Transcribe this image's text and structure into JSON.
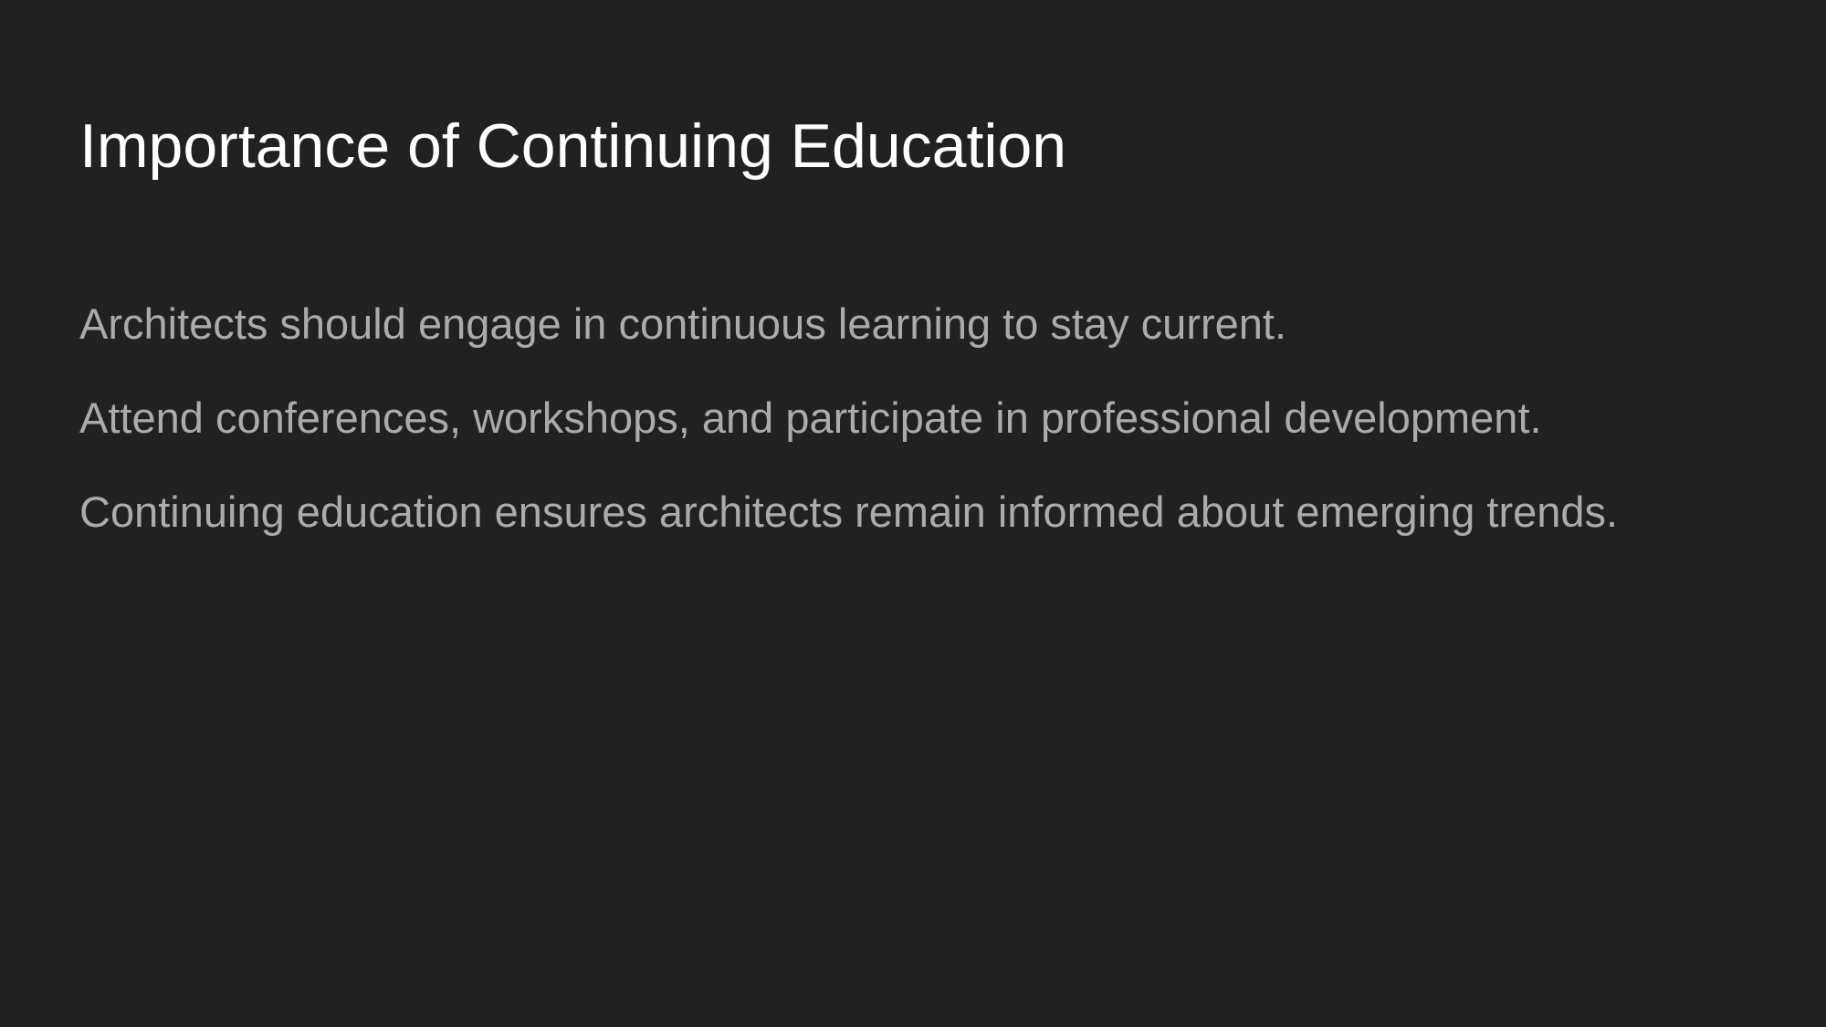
{
  "slide": {
    "title": "Importance of Continuing Education",
    "bullets": [
      "Architects should engage in continuous learning to stay current.",
      "Attend conferences, workshops, and participate in professional development.",
      "Continuing education ensures architects remain informed about emerging trends."
    ]
  },
  "colors": {
    "background": "#212121",
    "title": "#ffffff",
    "body_text": "#ababab"
  }
}
